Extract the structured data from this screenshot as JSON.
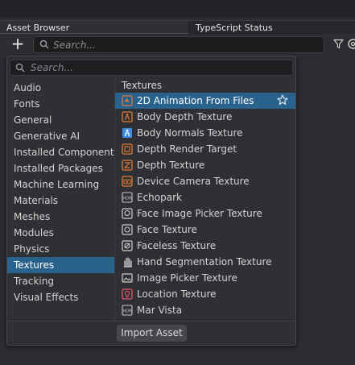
{
  "tabs": {
    "asset_browser": "Asset Browser",
    "typescript_status": "TypeScript Status"
  },
  "toolbar": {
    "add_label": "+",
    "search_placeholder": "Search..."
  },
  "popup": {
    "search_placeholder": "Search...",
    "categories": [
      "Audio",
      "Fonts",
      "General",
      "Generative AI",
      "Installed Components",
      "Installed Packages",
      "Machine Learning",
      "Materials",
      "Meshes",
      "Modules",
      "Physics",
      "Textures",
      "Tracking",
      "Visual Effects"
    ],
    "selected_category": "Textures",
    "section_header": "Textures",
    "assets": [
      {
        "label": "2D Animation From Files",
        "icon": "animation-icon"
      },
      {
        "label": "Body Depth Texture",
        "icon": "body-depth-icon"
      },
      {
        "label": "Body Normals Texture",
        "icon": "body-normals-icon"
      },
      {
        "label": "Depth Render Target",
        "icon": "depth-render-icon"
      },
      {
        "label": "Depth Texture",
        "icon": "depth-texture-icon"
      },
      {
        "label": "Device Camera Texture",
        "icon": "camera-icon"
      },
      {
        "label": "Echopark",
        "icon": "hdr-icon"
      },
      {
        "label": "Face Image Picker Texture",
        "icon": "face-image-icon"
      },
      {
        "label": "Face Texture",
        "icon": "face-icon"
      },
      {
        "label": "Faceless Texture",
        "icon": "faceless-icon"
      },
      {
        "label": "Hand Segmentation Texture",
        "icon": "hand-icon"
      },
      {
        "label": "Image Picker Texture",
        "icon": "image-picker-icon"
      },
      {
        "label": "Location Texture",
        "icon": "location-icon"
      },
      {
        "label": "Mar Vista",
        "icon": "hdr-icon"
      }
    ],
    "selected_asset": "2D Animation From Files",
    "import_button": "Import Asset"
  },
  "colors": {
    "selection": "#2a628e",
    "orange_icon": "#e07b39",
    "blue_icon": "#3a8ee6",
    "pink_icon": "#e0566b"
  }
}
